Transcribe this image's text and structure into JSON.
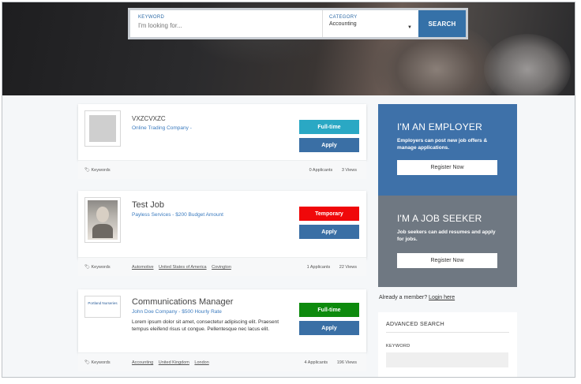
{
  "search": {
    "keyword_label": "KEYWORD",
    "keyword_placeholder": "I'm looking for...",
    "category_label": "CATEGORY",
    "category_value": "Accounting",
    "button_label": "SEARCH"
  },
  "jobs": [
    {
      "title": "VXZCVXZC",
      "company": "Online Trading Company -",
      "badge": "Full-time",
      "badge_color": "#2aa8c4",
      "apply_label": "Apply",
      "keywords_label": "Keywords",
      "tags": [],
      "applicants": "0 Applicants",
      "views": "3 Views"
    },
    {
      "title": "Test Job",
      "company": "Payless Services - $200 Budget Amount",
      "badge": "Temporary",
      "badge_color": "#f0080a",
      "apply_label": "Apply",
      "keywords_label": "Keywords",
      "tags": [
        "Automotive",
        "United States of America",
        "Covington"
      ],
      "applicants": "1 Applicants",
      "views": "22 Views"
    },
    {
      "title": "Communications Manager",
      "company": "John Doe Company - $500 Hourly Rate",
      "description": "Lorem ipsum dolor sit amet, consectetur adipiscing elit. Praesent tempus eleifend risus ut congue. Pellentesque nec lacus elit.",
      "logo_text": "Portland Nurseries",
      "badge": "Full-time",
      "badge_color": "#0d8a0d",
      "apply_label": "Apply",
      "keywords_label": "Keywords",
      "tags": [
        "Accounting",
        "United Kingdom",
        "London"
      ],
      "applicants": "4 Applicants",
      "views": "196 Views"
    }
  ],
  "employer": {
    "title": "I'M AN EMPLOYER",
    "text": "Employers can post new job offers & manage applications.",
    "button": "Register Now"
  },
  "seeker": {
    "title": "I'M A JOB SEEKER",
    "text": "Job seekers can add resumes and apply for jobs.",
    "button": "Register Now"
  },
  "member": {
    "text": "Already a member?",
    "link": "Login here"
  },
  "advanced": {
    "title": "ADVANCED SEARCH",
    "keyword_label": "KEYWORD"
  },
  "colors": {
    "brand_blue": "#3e71a9",
    "search_blue": "#3571a8",
    "seeker_gray": "#6f7882"
  },
  "icons": {
    "tag": "tag-icon",
    "caret": "chevron-down-icon"
  }
}
